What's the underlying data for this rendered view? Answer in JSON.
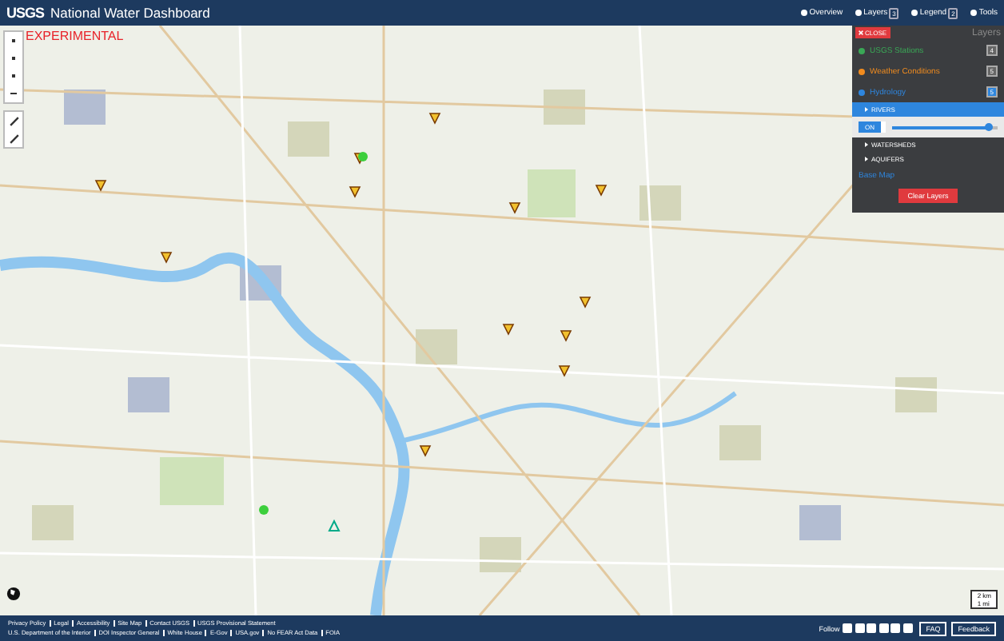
{
  "header": {
    "logo": "USGS",
    "title": "National Water Dashboard",
    "nav": [
      {
        "label": "Overview"
      },
      {
        "label": "Layers",
        "badge": "3"
      },
      {
        "label": "Legend",
        "badge": "2"
      },
      {
        "label": "Tools"
      }
    ]
  },
  "map": {
    "banner": "EXPERIMENTAL",
    "scale": [
      "2 km",
      "1 mi"
    ]
  },
  "layers_panel": {
    "close": "CLOSE",
    "title": "Layers",
    "groups": [
      {
        "label": "USGS Stations",
        "color": "#3aa856",
        "badge": "4",
        "expanded": false
      },
      {
        "label": "Weather Conditions",
        "color": "#f28c1e",
        "badge": "5",
        "expanded": false
      },
      {
        "label": "Hydrology",
        "color": "#2e86de",
        "badge": "5",
        "expanded": true
      }
    ],
    "sublayers": [
      {
        "label": "RIVERS",
        "selected": true,
        "on_label": "ON",
        "level": 0.92
      },
      {
        "label": "WATERSHEDS",
        "selected": false
      },
      {
        "label": "AQUIFERS",
        "selected": false
      }
    ],
    "base_map": "Base Map",
    "clear": "Clear Layers"
  },
  "footer": {
    "links_1": [
      "Privacy Policy",
      "Legal",
      "Accessibility",
      "Site Map",
      "Contact USGS",
      "USGS Provisional Statement"
    ],
    "links_2": [
      "U.S. Department of the Interior",
      "DOI Inspector General",
      "White House",
      "E-Gov",
      "USA.gov",
      "No FEAR Act Data",
      "FOIA"
    ],
    "follow": "Follow",
    "buttons": [
      "FAQ",
      "Feedback"
    ]
  }
}
